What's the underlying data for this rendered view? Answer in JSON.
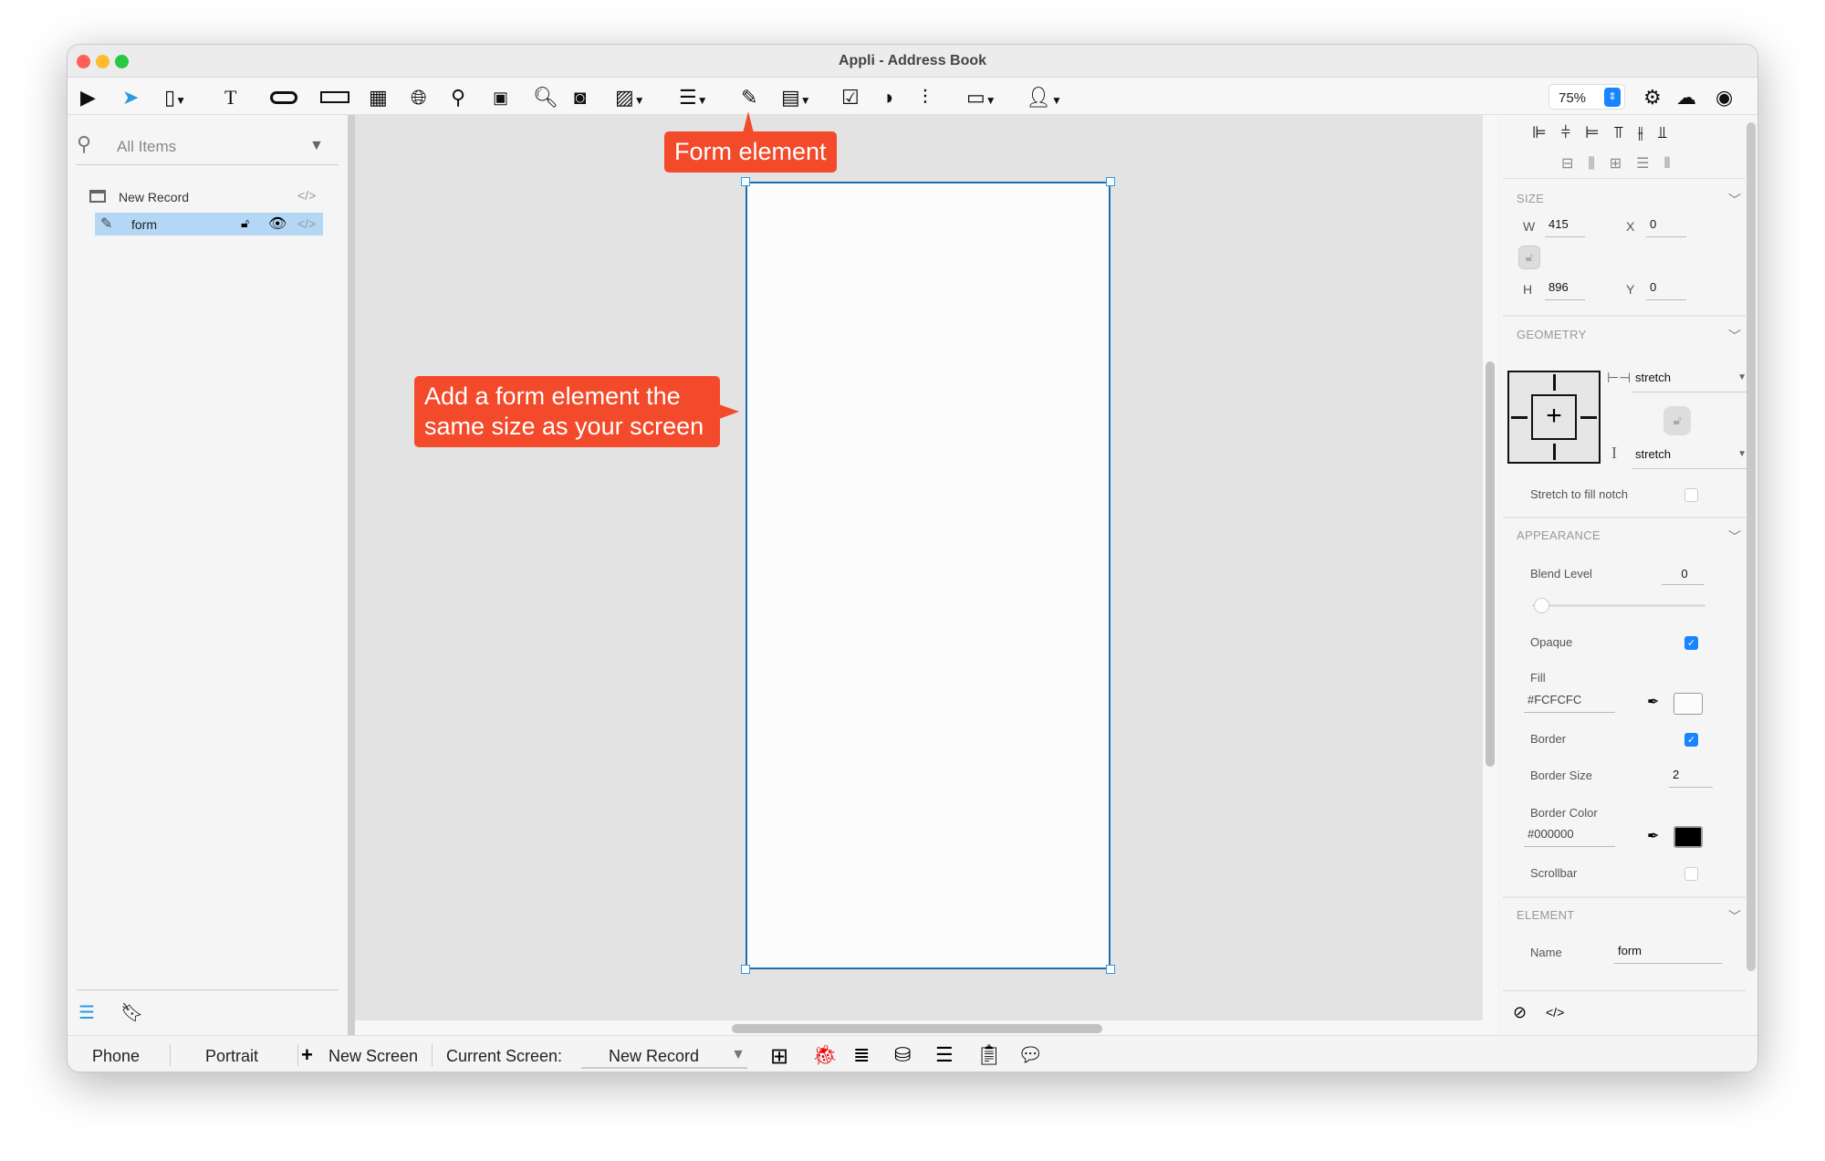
{
  "window": {
    "title": "Appli - Address Book"
  },
  "toolbar": {
    "zoom": "75%",
    "icons": [
      "play-icon",
      "pointer-icon",
      "rectangle-icon",
      "text-icon",
      "button-icon",
      "text-field-icon",
      "table-icon",
      "web-icon",
      "map-pin-icon",
      "chart-icon",
      "search-icon",
      "camera-icon",
      "image-icon",
      "list-icon",
      "form-icon",
      "picker-icon",
      "checkbox-icon",
      "toggle-icon",
      "slider-icon",
      "calendar-icon",
      "contact-icon",
      "gear-icon",
      "cloud-upload-icon",
      "account-icon"
    ]
  },
  "left_panel": {
    "search_placeholder": "All Items",
    "tree": [
      {
        "label": "New Record"
      },
      {
        "label": "form",
        "selected": true
      }
    ]
  },
  "callouts": {
    "top": "Form element",
    "middle": "Add a form element the same size as your screen"
  },
  "right_panel": {
    "size": {
      "title": "SIZE",
      "w_label": "W",
      "w": "415",
      "h_label": "H",
      "h": "896",
      "x_label": "X",
      "x": "0",
      "y_label": "Y",
      "y": "0"
    },
    "geometry": {
      "title": "GEOMETRY",
      "horizontal": "stretch",
      "vertical": "stretch",
      "notch_label": "Stretch to fill notch",
      "notch": false
    },
    "appearance": {
      "title": "APPEARANCE",
      "blend_label": "Blend Level",
      "blend": "0",
      "opaque_label": "Opaque",
      "opaque": true,
      "fill_label": "Fill",
      "fill": "#FCFCFC",
      "border_label": "Border",
      "border": true,
      "border_size_label": "Border Size",
      "border_size": "2",
      "border_color_label": "Border Color",
      "border_color": "#000000",
      "scrollbar_label": "Scrollbar",
      "scrollbar": false
    },
    "element": {
      "title": "ELEMENT",
      "name_label": "Name",
      "name": "form"
    }
  },
  "bottom_bar": {
    "device": "Phone",
    "orientation": "Portrait",
    "new_screen": "New Screen",
    "current_label": "Current Screen:",
    "current": "New Record"
  },
  "colors": {
    "accent": "#1a84ff",
    "callout": "#f24a2a",
    "selection": "#b3d7f5",
    "form_border": "#1a6fb0"
  }
}
